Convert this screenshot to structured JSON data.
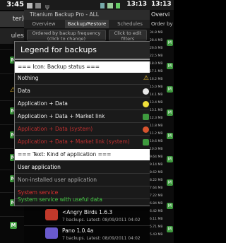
{
  "left_panel": {
    "time": "3:45",
    "title": "ter)",
    "tab": "ules"
  },
  "center_panel": {
    "status_time": "13:13",
    "app_title": "Titanium Backup Pro - ALL",
    "tabs": [
      "Overview",
      "Backup/Restore",
      "Schedules"
    ],
    "toolbar": {
      "order_button": "Ordered by backup frequency (click to change)",
      "filter_button": "Click to edit filters"
    },
    "dialog": {
      "title": "Legend for backups",
      "section1_header": "=== Icon: Backup status ===",
      "icon_rows": [
        {
          "label": "Nothing",
          "icon": "warning-icon"
        },
        {
          "label": "Data",
          "icon": "data-icon"
        },
        {
          "label": "Application + Data",
          "icon": "smiley-yellow-icon"
        },
        {
          "label": "Application + Data + Market link",
          "icon": "smiley-green-icon"
        },
        {
          "label": "Application + Data (system)",
          "icon": "circle-red-icon"
        },
        {
          "label": "Application + Data + Market link (system)",
          "icon": "circle-green-icon"
        }
      ],
      "section2_header": "=== Text: Kind of application ===",
      "kind_rows": [
        {
          "label": "User application",
          "color": "#ffffff"
        },
        {
          "label": "Non-installed user application",
          "color": "#aaaaaa"
        },
        {
          "label": "System service",
          "color": "#e03030"
        },
        {
          "label": "System service with useful data",
          "color": "#44cc44"
        }
      ]
    },
    "list": [
      {
        "title": "<Angry Birds 1.6.3",
        "subtitle": "7 backups. Latest: 08/09/2011 04:02"
      },
      {
        "title": "Pano 1.0.4a",
        "subtitle": "7 backups. Latest: 08/09/2011 04:02"
      }
    ]
  },
  "right_panel": {
    "status_time": "13:13",
    "title": "Overvi",
    "order": "Order by",
    "sizes": [
      "34.8 MB",
      "28.4 MB",
      "26.6 MB",
      "22.5 MB",
      "18.0 MB",
      "17.1 MB",
      "16.2 MB",
      "15.0 MB",
      "14.1 MB",
      "13.4 MB",
      "13.1 MB",
      "12.3 MB",
      "11.8 MB",
      "11.2 MB",
      "10.6 MB",
      "10.0 MB",
      "9.64 MB",
      "9.14 MB",
      "8.62 MB",
      "8.22 MB",
      "7.64 MB",
      "7.22 MB",
      "6.84 MB",
      "6.42 MB",
      "6.11 MB",
      "5.71 MB",
      "5.43 MB"
    ]
  },
  "colors": {
    "accent_green": "#3e9a3e",
    "header_bg": "#ffffff",
    "system_red": "#e03030",
    "useful_green": "#44cc44"
  }
}
